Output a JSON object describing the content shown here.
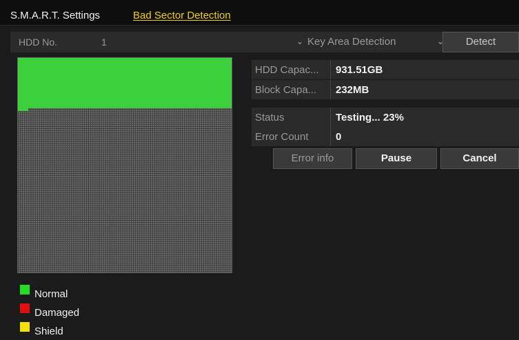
{
  "tabs": [
    {
      "label": "S.M.A.R.T. Settings"
    },
    {
      "label": "Bad Sector Detection"
    }
  ],
  "hdd": {
    "label": "HDD No.",
    "value": "1",
    "mode": "Key Area Detection",
    "detect_label": "Detect"
  },
  "info": {
    "capacity_label": "HDD Capac...",
    "capacity_value": "931.51GB",
    "block_label": "Block Capa...",
    "block_value": "232MB",
    "status_label": "Status",
    "status_value": "Testing... 23%",
    "error_label": "Error Count",
    "error_value": "0"
  },
  "progress": 0.23,
  "buttons": {
    "error_info": "Error info",
    "pause": "Pause",
    "cancel": "Cancel"
  },
  "legend": [
    {
      "label": "Normal",
      "color": "#22dd22"
    },
    {
      "label": "Damaged",
      "color": "#e01010"
    },
    {
      "label": "Shield",
      "color": "#f0e000"
    }
  ]
}
